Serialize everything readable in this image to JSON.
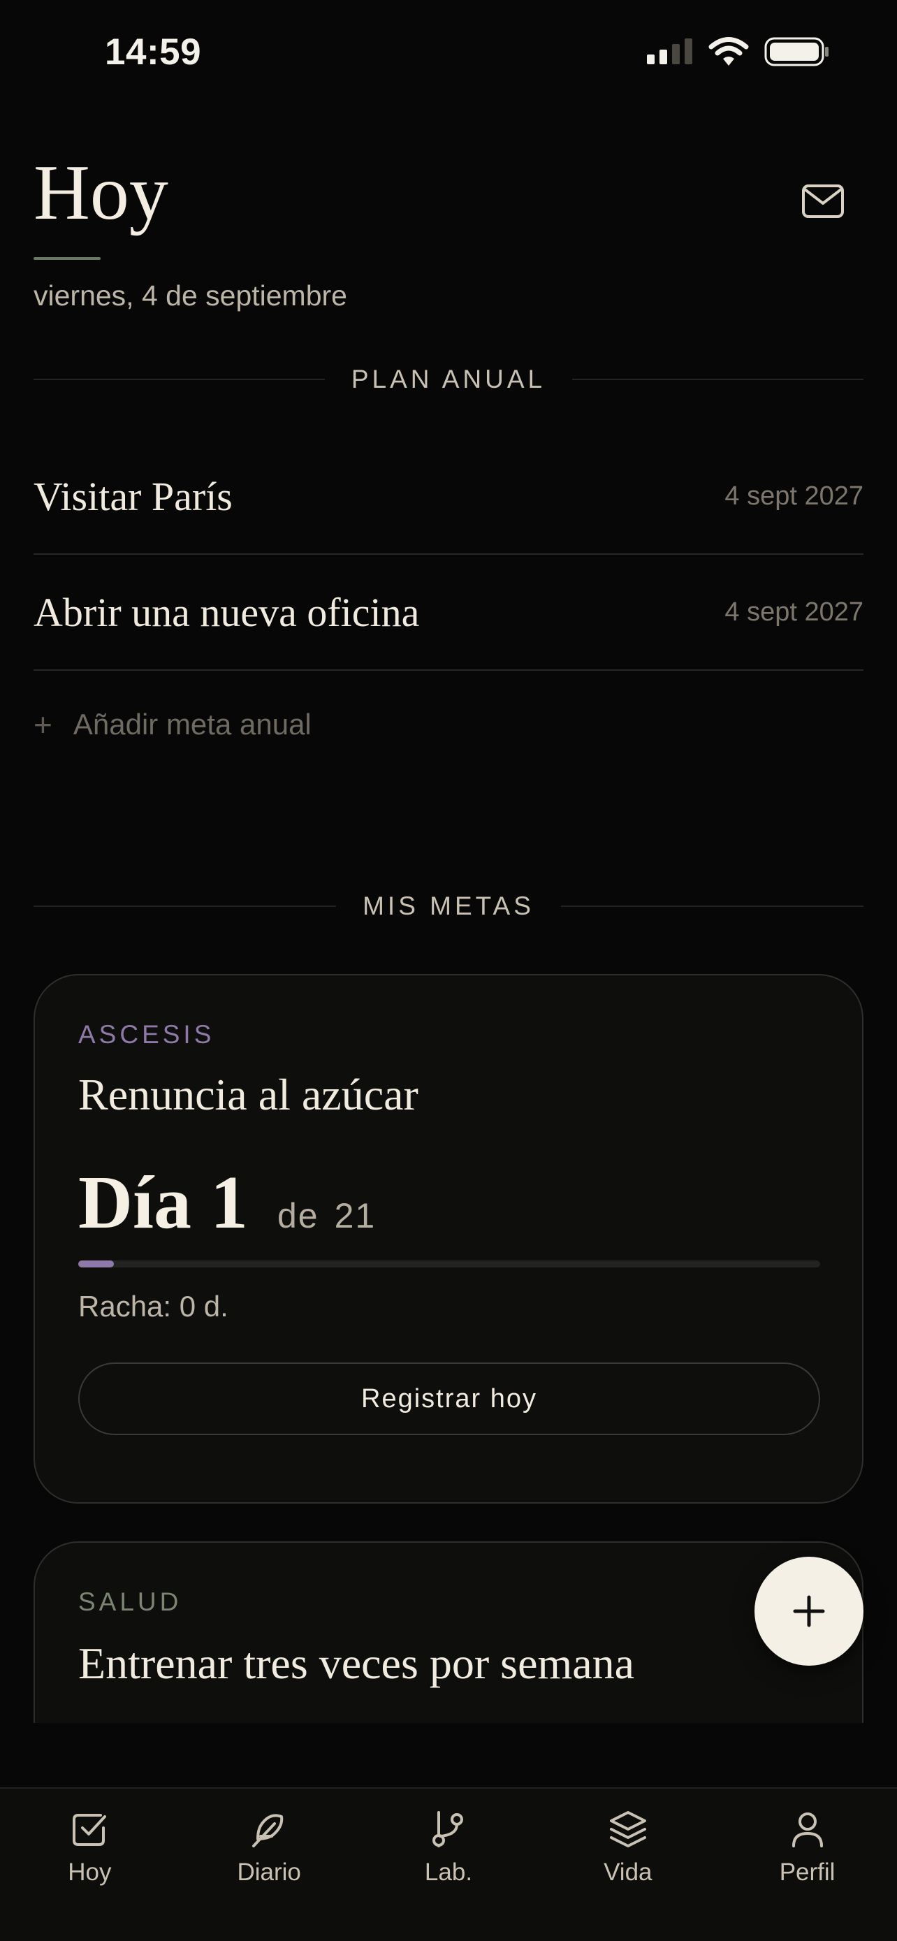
{
  "status_bar": {
    "time": "14:59"
  },
  "header": {
    "title": "Hoy",
    "date": "viernes, 4 de septiembre"
  },
  "annual_plan": {
    "label": "PLAN ANUAL",
    "items": [
      {
        "name": "Visitar París",
        "date": "4 sept 2027"
      },
      {
        "name": "Abrir una nueva oficina",
        "date": "4 sept 2027"
      }
    ],
    "add_label": "Añadir meta anual"
  },
  "my_goals": {
    "label": "MIS METAS",
    "cards": [
      {
        "category": "ASCESIS",
        "category_color": "#8e79a8",
        "title": "Renuncia al azúcar",
        "day_label": "Día 1",
        "of_label": "de",
        "total": "21",
        "progress": 0.048,
        "streak": "Racha: 0 d.",
        "button": "Registrar hoy"
      },
      {
        "category": "SALUD",
        "category_color": "#7c8571",
        "title": "Entrenar tres veces por semana"
      }
    ]
  },
  "nav": {
    "items": [
      {
        "label": "Hoy",
        "icon": "checkbox-icon"
      },
      {
        "label": "Diario",
        "icon": "feather-icon"
      },
      {
        "label": "Lab.",
        "icon": "git-branch-icon"
      },
      {
        "label": "Vida",
        "icon": "layers-icon"
      },
      {
        "label": "Perfil",
        "icon": "user-icon"
      }
    ]
  },
  "colors": {
    "background": "#070707",
    "accent_purple": "#8e79a8",
    "accent_green": "#6b7766",
    "fab": "#f5f0e6"
  }
}
